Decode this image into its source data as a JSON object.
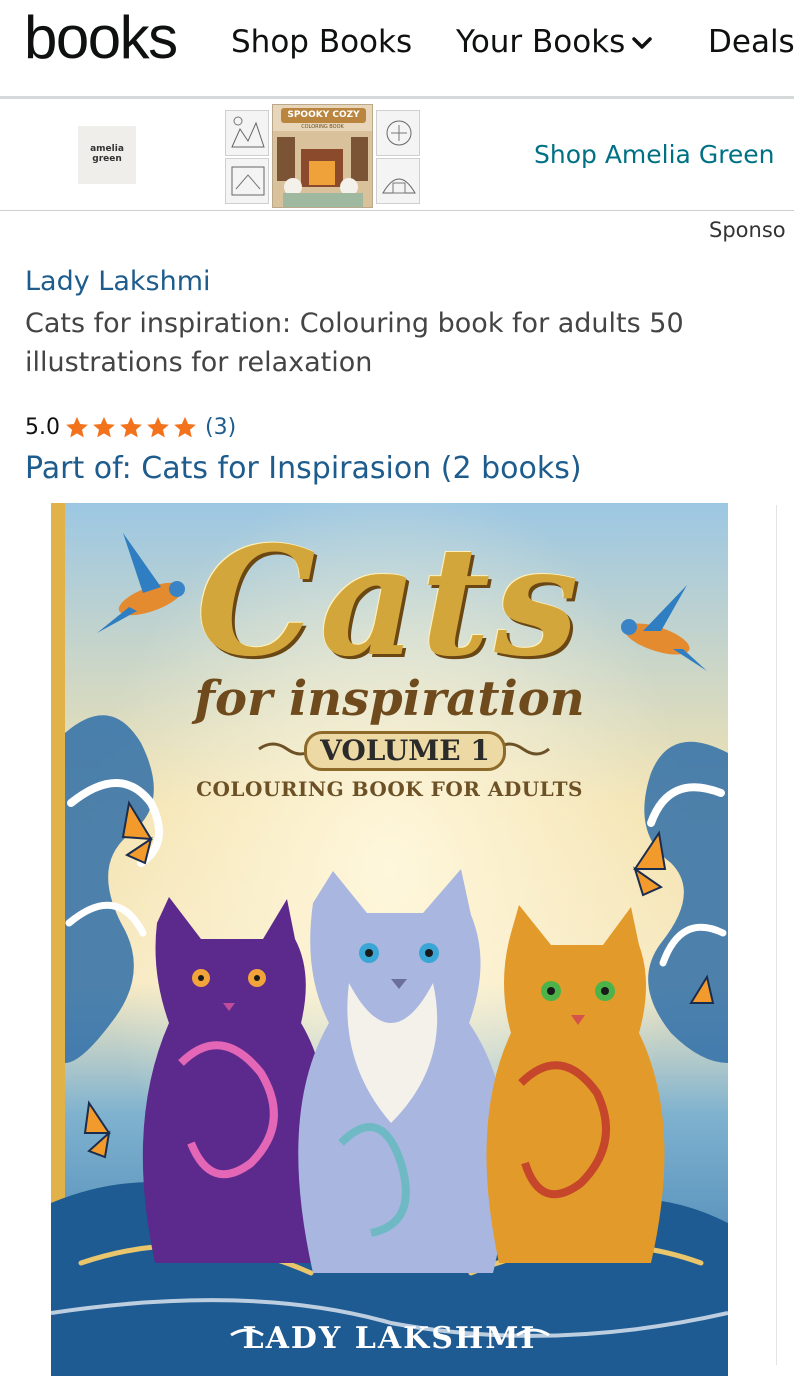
{
  "nav": {
    "brand": "books",
    "shop_books": "Shop Books",
    "your_books": "Your Books",
    "deals": "Deals"
  },
  "ad": {
    "logo_line1": "amelia",
    "logo_line2": "green",
    "thumb_title": "SPOOKY COZY",
    "thumb_subtitle": "COLORING BOOK",
    "shop_link": "Shop Amelia Green",
    "sponsored": "Sponso"
  },
  "product": {
    "author": "Lady Lakshmi",
    "title": "Cats for inspiration: Colouring book for adults 50 illustrations for relaxation",
    "rating_value": "5.0",
    "stars_filled": 5,
    "rating_count": "(3)",
    "series": "Part of: Cats for Inspirasion (2 books)"
  },
  "cover": {
    "title": "Cats",
    "subtitle": "for inspiration",
    "volume": "VOLUME 1",
    "tagline": "COLOURING BOOK FOR ADULTS",
    "author": "LADY LAKSHMI",
    "colors": {
      "sky": "#f4e3b0",
      "water": "#2f6fa8",
      "purple_cat": "#5b2a8c",
      "silver_cat": "#a9b7e0",
      "orange_cat": "#e29a2a",
      "gold": "#d3a63c"
    }
  }
}
